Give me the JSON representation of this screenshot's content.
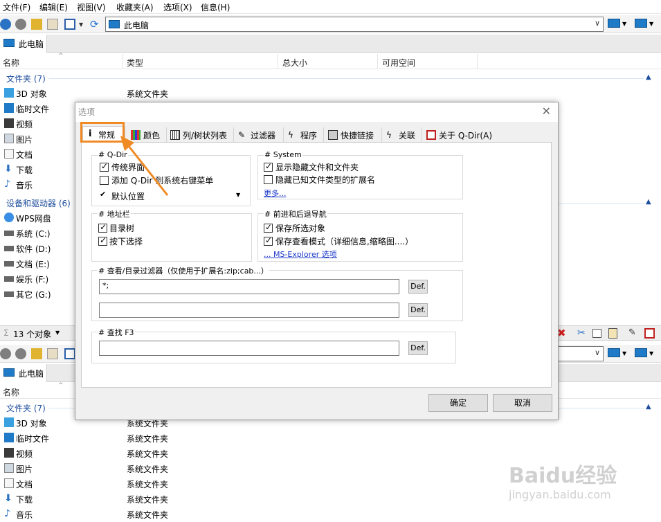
{
  "menu": [
    "文件(F)",
    "编辑(E)",
    "视图(V)",
    "收藏夹(A)",
    "选项(X)",
    "信息(H)"
  ],
  "address": "此电脑",
  "tab_label": "此电脑",
  "columns": [
    "名称",
    "类型",
    "总大小",
    "可用空间"
  ],
  "group_folders": "文件夹 (7)",
  "group_devices": "设备和驱动器 (6)",
  "folders": [
    {
      "name": "3D 对象",
      "type": "系统文件夹"
    },
    {
      "name": "临时文件",
      "type": ""
    },
    {
      "name": "视频",
      "type": ""
    },
    {
      "name": "图片",
      "type": ""
    },
    {
      "name": "文档",
      "type": ""
    },
    {
      "name": "下载",
      "type": ""
    },
    {
      "name": "音乐",
      "type": ""
    }
  ],
  "drives": [
    "WPS网盘",
    "系统 (C:)",
    "软件 (D:)",
    "文档 (E:)",
    "娱乐 (F:)",
    "其它 (G:)"
  ],
  "status_count": "13 个对象",
  "bottom_folders": [
    {
      "name": "3D 对象",
      "type": "系统文件夹"
    },
    {
      "name": "临时文件",
      "type": "系统文件夹"
    },
    {
      "name": "视频",
      "type": "系统文件夹"
    },
    {
      "name": "图片",
      "type": "系统文件夹"
    },
    {
      "name": "文档",
      "type": "系统文件夹"
    },
    {
      "name": "下载",
      "type": "系统文件夹"
    },
    {
      "name": "音乐",
      "type": "系统文件夹"
    }
  ],
  "watermark": {
    "text": "Baidu经验",
    "sub": "jingyan.baidu.com"
  },
  "dialog": {
    "title": "选项",
    "tabs": [
      "常规",
      "颜色",
      "列/树状列表",
      "过滤器",
      "程序",
      "快捷链接",
      "关联",
      "关于 Q-Dir(A)"
    ],
    "qdir": {
      "legend": "# Q-Dir",
      "classic": "传统界面",
      "context": "添加 Q-Dir 到系统右键菜单",
      "default_pos": "默认位置"
    },
    "system": {
      "legend": "# System",
      "show_hidden": "显示隐藏文件和文件夹",
      "hide_ext": "隐藏已知文件类型的扩展名",
      "more": "更多..."
    },
    "addressbar": {
      "legend": "# 地址栏",
      "tree": "目录树",
      "press_select": "按下选择"
    },
    "nav": {
      "legend": "# 前进和后退导航",
      "save_selected": "保存所选对象",
      "save_view": "保存查看模式（详细信息,缩略图....）",
      "ms_link": "... MS-Explorer 选项"
    },
    "filter": {
      "legend": "# 查看/目录过滤器（仅使用于扩展名:zip;cab...）",
      "value1": "*;",
      "value2": "",
      "def": "Def."
    },
    "find": {
      "legend": "# 查找   F3",
      "value": "",
      "def": "Def."
    },
    "ok": "确定",
    "cancel": "取消"
  }
}
